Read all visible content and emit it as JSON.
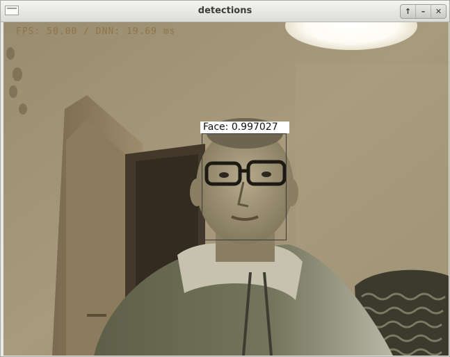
{
  "window": {
    "title": "detections",
    "controls": {
      "restore": "↑",
      "minimize": "–",
      "close": "✕"
    }
  },
  "overlay": {
    "fps_text": "FPS: 50.00 / DNN: 19.69 ms"
  },
  "detection": {
    "label": "Face: 0.997027",
    "class": "Face",
    "confidence": 0.997027
  },
  "colors": {
    "box": "#3a3a3a",
    "label_bg": "#ffffff",
    "label_text": "#111111"
  }
}
